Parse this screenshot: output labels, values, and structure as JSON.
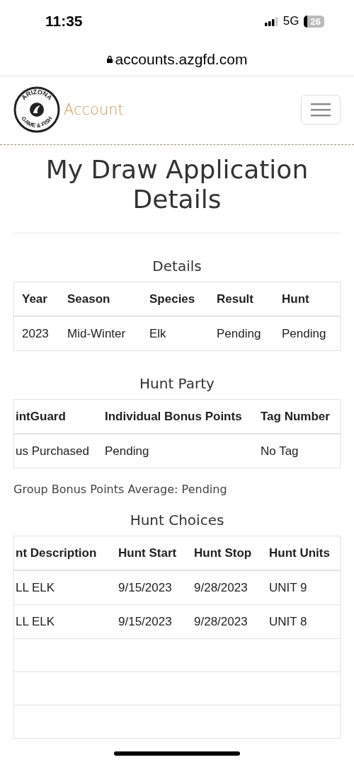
{
  "status_bar": {
    "time": "11:35",
    "network": "5G",
    "battery": "26"
  },
  "browser": {
    "url": "accounts.azgfd.com"
  },
  "header": {
    "logo_top": "ARIZONA",
    "logo_bottom": "GAME & FISH",
    "title": "Account"
  },
  "page_title": "My Draw Application Details",
  "details": {
    "heading": "Details",
    "columns": [
      "Year",
      "Season",
      "Species",
      "Result",
      "Hunt"
    ],
    "rows": [
      [
        "2023",
        "Mid-Winter",
        "Elk",
        "Pending",
        "Pending"
      ]
    ]
  },
  "hunt_party": {
    "heading": "Hunt Party",
    "columns": [
      "intGuard",
      "Individual Bonus Points",
      "Tag Number"
    ],
    "rows": [
      [
        "us Purchased",
        "Pending",
        "No Tag"
      ]
    ],
    "group_average": "Group Bonus Points Average: Pending"
  },
  "hunt_choices": {
    "heading": "Hunt Choices",
    "columns": [
      "nt Description",
      "Hunt Start",
      "Hunt Stop",
      "Hunt Units"
    ],
    "rows": [
      [
        "LL ELK",
        "9/15/2023",
        "9/28/2023",
        "UNIT 9"
      ],
      [
        "LL ELK",
        "9/15/2023",
        "9/28/2023",
        "UNIT 8"
      ]
    ]
  }
}
